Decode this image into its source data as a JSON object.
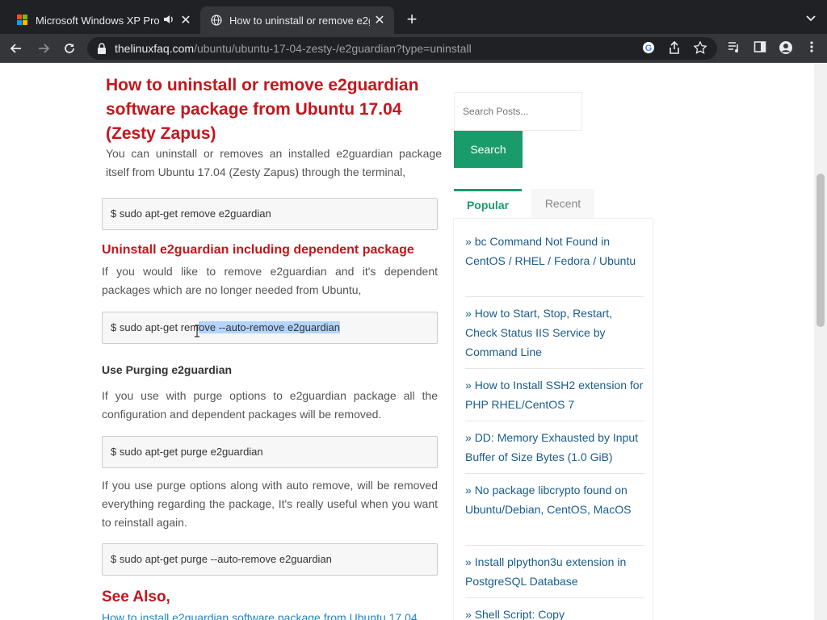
{
  "browser": {
    "tabs": [
      {
        "title": "Microsoft Windows XP Pro",
        "active": false,
        "audio": true
      },
      {
        "title": "How to uninstall or remove e2g",
        "active": true,
        "audio": false
      }
    ],
    "url_host": "thelinuxfaq.com",
    "url_path": "/ubuntu/ubuntu-17-04-zesty-/e2guardian?type=uninstall"
  },
  "article": {
    "title": "How to uninstall or remove e2guardian software package from Ubuntu 17.04 (Zesty Zapus)",
    "intro": "You can uninstall or removes an installed e2guardian package itself from Ubuntu 17.04 (Zesty Zapus) through the terminal,",
    "cmd_remove": "$ sudo apt-get remove e2guardian",
    "h_dependent": "Uninstall e2guardian including dependent package",
    "p_dependent": "If you would like to remove e2guardian and it's dependent packages which are no longer needed from Ubuntu,",
    "cmd_autoremove_pre": "$ sudo apt-get rem",
    "cmd_autoremove_sel": "ove --auto-remove e2guardian",
    "h_purging": "Use Purging e2guardian",
    "p_purging": "If you use with purge options to e2guardian package all the configuration and dependent packages will be removed.",
    "cmd_purge": "$ sudo apt-get purge e2guardian",
    "p_purge_auto": "If you use purge options along with auto remove, will be removed everything regarding the package, It's really useful when you want to reinstall again.",
    "cmd_purge_auto": "$ sudo apt-get purge --auto-remove e2guardian",
    "h_see_also": "See Also,",
    "link_install": "How to install e2guardian software package from Ubuntu 17.04"
  },
  "sidebar": {
    "search_placeholder": "Search Posts...",
    "search_button": "Search",
    "tab_popular": "Popular",
    "tab_recent": "Recent",
    "posts": [
      "bc Command Not Found in CentOS / RHEL / Fedora / Ubuntu",
      "How to Start, Stop, Restart, Check Status IIS Service by Command Line",
      "How to Install SSH2 extension for PHP RHEL/CentOS 7",
      "DD: Memory Exhausted by Input Buffer of Size Bytes (1.0 GiB)",
      "No package libcrypto found on Ubuntu/Debian, CentOS, MacOS",
      "Install plpython3u extension in PostgreSQL Database",
      "Shell Script: Copy"
    ]
  },
  "colors": {
    "heading_red": "#c4161c",
    "accent_green": "#1a9b6c",
    "link_blue": "#1a5c8c"
  }
}
